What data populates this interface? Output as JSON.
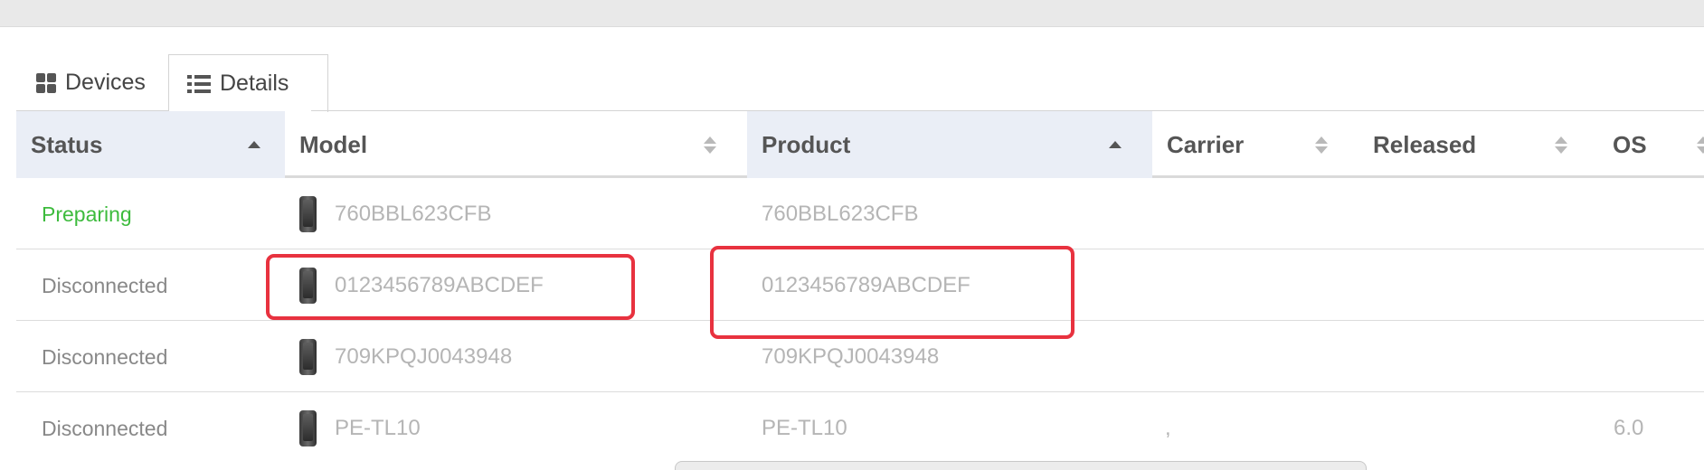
{
  "tabs": [
    {
      "label": "Devices",
      "icon": "grid-icon"
    },
    {
      "label": "Details",
      "icon": "list-icon",
      "active": true
    }
  ],
  "columns": [
    {
      "label": "Status",
      "sort": "asc"
    },
    {
      "label": "Model",
      "sort": "none"
    },
    {
      "label": "Product",
      "sort": "asc"
    },
    {
      "label": "Carrier",
      "sort": "none"
    },
    {
      "label": "Released",
      "sort": "none"
    },
    {
      "label": "OS",
      "sort": "none"
    }
  ],
  "rows": [
    {
      "status": "Preparing",
      "model": "760BBL623CFB",
      "product": "760BBL623CFB",
      "carrier": "",
      "released": "",
      "os": ""
    },
    {
      "status": "Disconnected",
      "model": "0123456789ABCDEF",
      "product": "0123456789ABCDEF",
      "carrier": "",
      "released": "",
      "os": ""
    },
    {
      "status": "Disconnected",
      "model": "709KPQJ0043948",
      "product": "709KPQJ0043948",
      "carrier": "",
      "released": "",
      "os": ""
    },
    {
      "status": "Disconnected",
      "model": "PE-TL10",
      "product": "PE-TL10",
      "carrier": ",",
      "released": "",
      "os": "6.0"
    }
  ],
  "colors": {
    "status_ok": "#3dbb3d",
    "highlight": "#e8323f",
    "sorted_header": "#eaeef6"
  }
}
